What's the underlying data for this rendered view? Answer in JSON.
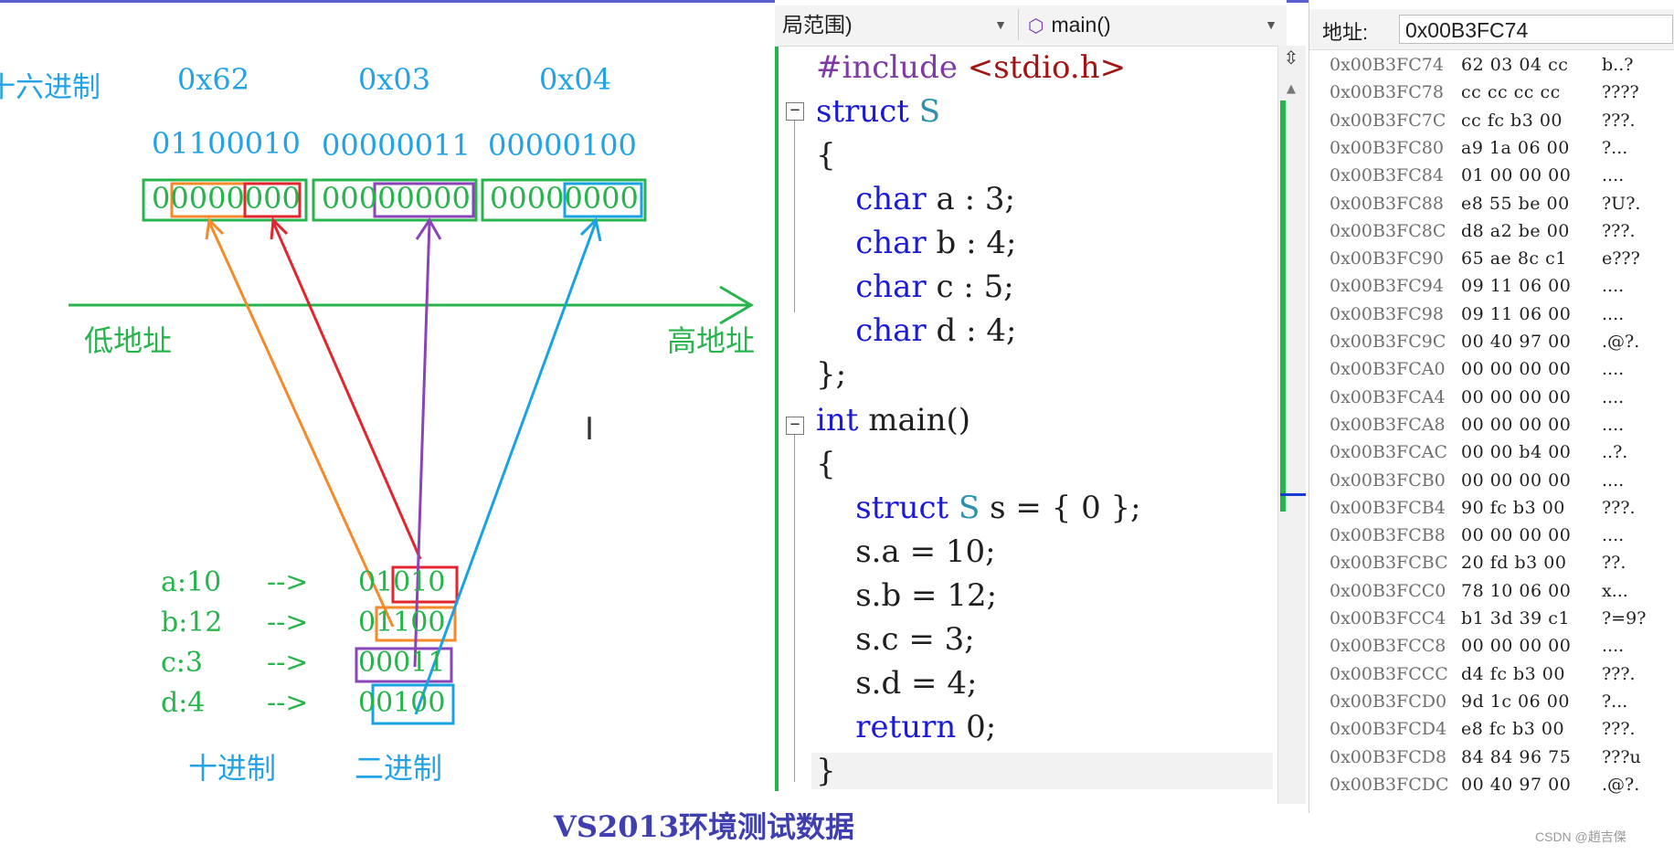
{
  "whiteboard": {
    "label_hex": "十六进制",
    "hex": [
      "0x62",
      "0x03",
      "0x04"
    ],
    "bin_top": [
      "01100010",
      "00000011",
      "00000100"
    ],
    "bytes_boxed": [
      "00000000",
      "00000000",
      "00000000"
    ],
    "label_low_addr": "低地址",
    "label_high_addr": "高地址",
    "rows": [
      {
        "label": "a:10",
        "arrow": "-->",
        "bin": "01010"
      },
      {
        "label": "b:12",
        "arrow": "-->",
        "bin": "01100"
      },
      {
        "label": "c:3",
        "arrow": "-->",
        "bin": "00011"
      },
      {
        "label": "d:4",
        "arrow": "-->",
        "bin": "00100"
      }
    ],
    "label_decimal": "十进制",
    "label_binary": "二进制",
    "caption": "VS2013环境测试数据",
    "colors": {
      "orange": "#f58a2a",
      "red": "#e0262e",
      "purple": "#8a44b8",
      "blue": "#1aa3e3",
      "green": "#27b44c"
    }
  },
  "editor": {
    "scope_dropdown": "局范围)",
    "function_dropdown": "main()",
    "lines": [
      {
        "text": "#include <stdio.h>"
      },
      {
        "text": "struct S"
      },
      {
        "text": "{"
      },
      {
        "text": "    char a : 3;"
      },
      {
        "text": "    char b : 4;"
      },
      {
        "text": "    char c : 5;"
      },
      {
        "text": "    char d : 4;"
      },
      {
        "text": "};"
      },
      {
        "text": "int main()"
      },
      {
        "text": "{"
      },
      {
        "text": "    struct S s = { 0 };"
      },
      {
        "text": "    s.a = 10;"
      },
      {
        "text": "    s.b = 12;"
      },
      {
        "text": "    s.c = 3;"
      },
      {
        "text": "    s.d = 4;"
      },
      {
        "text": "    return 0;"
      },
      {
        "text": "}"
      }
    ]
  },
  "memory": {
    "address_label": "地址:",
    "address_value": "0x00B3FC74",
    "rows": [
      {
        "addr": "0x00B3FC74",
        "bytes": "62 03 04 cc",
        "ascii": "b..?"
      },
      {
        "addr": "0x00B3FC78",
        "bytes": "cc cc cc cc",
        "ascii": "????"
      },
      {
        "addr": "0x00B3FC7C",
        "bytes": "cc fc b3 00",
        "ascii": "???."
      },
      {
        "addr": "0x00B3FC80",
        "bytes": "a9 1a 06 00",
        "ascii": "?..."
      },
      {
        "addr": "0x00B3FC84",
        "bytes": "01 00 00 00",
        "ascii": "...."
      },
      {
        "addr": "0x00B3FC88",
        "bytes": "e8 55 be 00",
        "ascii": "?U?."
      },
      {
        "addr": "0x00B3FC8C",
        "bytes": "d8 a2 be 00",
        "ascii": "???."
      },
      {
        "addr": "0x00B3FC90",
        "bytes": "65 ae 8c c1",
        "ascii": "e???"
      },
      {
        "addr": "0x00B3FC94",
        "bytes": "09 11 06 00",
        "ascii": "...."
      },
      {
        "addr": "0x00B3FC98",
        "bytes": "09 11 06 00",
        "ascii": "...."
      },
      {
        "addr": "0x00B3FC9C",
        "bytes": "00 40 97 00",
        "ascii": ".@?."
      },
      {
        "addr": "0x00B3FCA0",
        "bytes": "00 00 00 00",
        "ascii": "...."
      },
      {
        "addr": "0x00B3FCA4",
        "bytes": "00 00 00 00",
        "ascii": "...."
      },
      {
        "addr": "0x00B3FCA8",
        "bytes": "00 00 00 00",
        "ascii": "...."
      },
      {
        "addr": "0x00B3FCAC",
        "bytes": "00 00 b4 00",
        "ascii": "..?."
      },
      {
        "addr": "0x00B3FCB0",
        "bytes": "00 00 00 00",
        "ascii": "...."
      },
      {
        "addr": "0x00B3FCB4",
        "bytes": "90 fc b3 00",
        "ascii": "???."
      },
      {
        "addr": "0x00B3FCB8",
        "bytes": "00 00 00 00",
        "ascii": "...."
      },
      {
        "addr": "0x00B3FCBC",
        "bytes": "20 fd b3 00",
        "ascii": " ??."
      },
      {
        "addr": "0x00B3FCC0",
        "bytes": "78 10 06 00",
        "ascii": "x..."
      },
      {
        "addr": "0x00B3FCC4",
        "bytes": "b1 3d 39 c1",
        "ascii": "?=9?"
      },
      {
        "addr": "0x00B3FCC8",
        "bytes": "00 00 00 00",
        "ascii": "...."
      },
      {
        "addr": "0x00B3FCCC",
        "bytes": "d4 fc b3 00",
        "ascii": "???."
      },
      {
        "addr": "0x00B3FCD0",
        "bytes": "9d 1c 06 00",
        "ascii": "?..."
      },
      {
        "addr": "0x00B3FCD4",
        "bytes": "e8 fc b3 00",
        "ascii": "???."
      },
      {
        "addr": "0x00B3FCD8",
        "bytes": "84 84 96 75",
        "ascii": "???u"
      },
      {
        "addr": "0x00B3FCDC",
        "bytes": "00 40 97 00",
        "ascii": ".@?."
      }
    ]
  },
  "watermark": "CSDN @趙吉傑"
}
